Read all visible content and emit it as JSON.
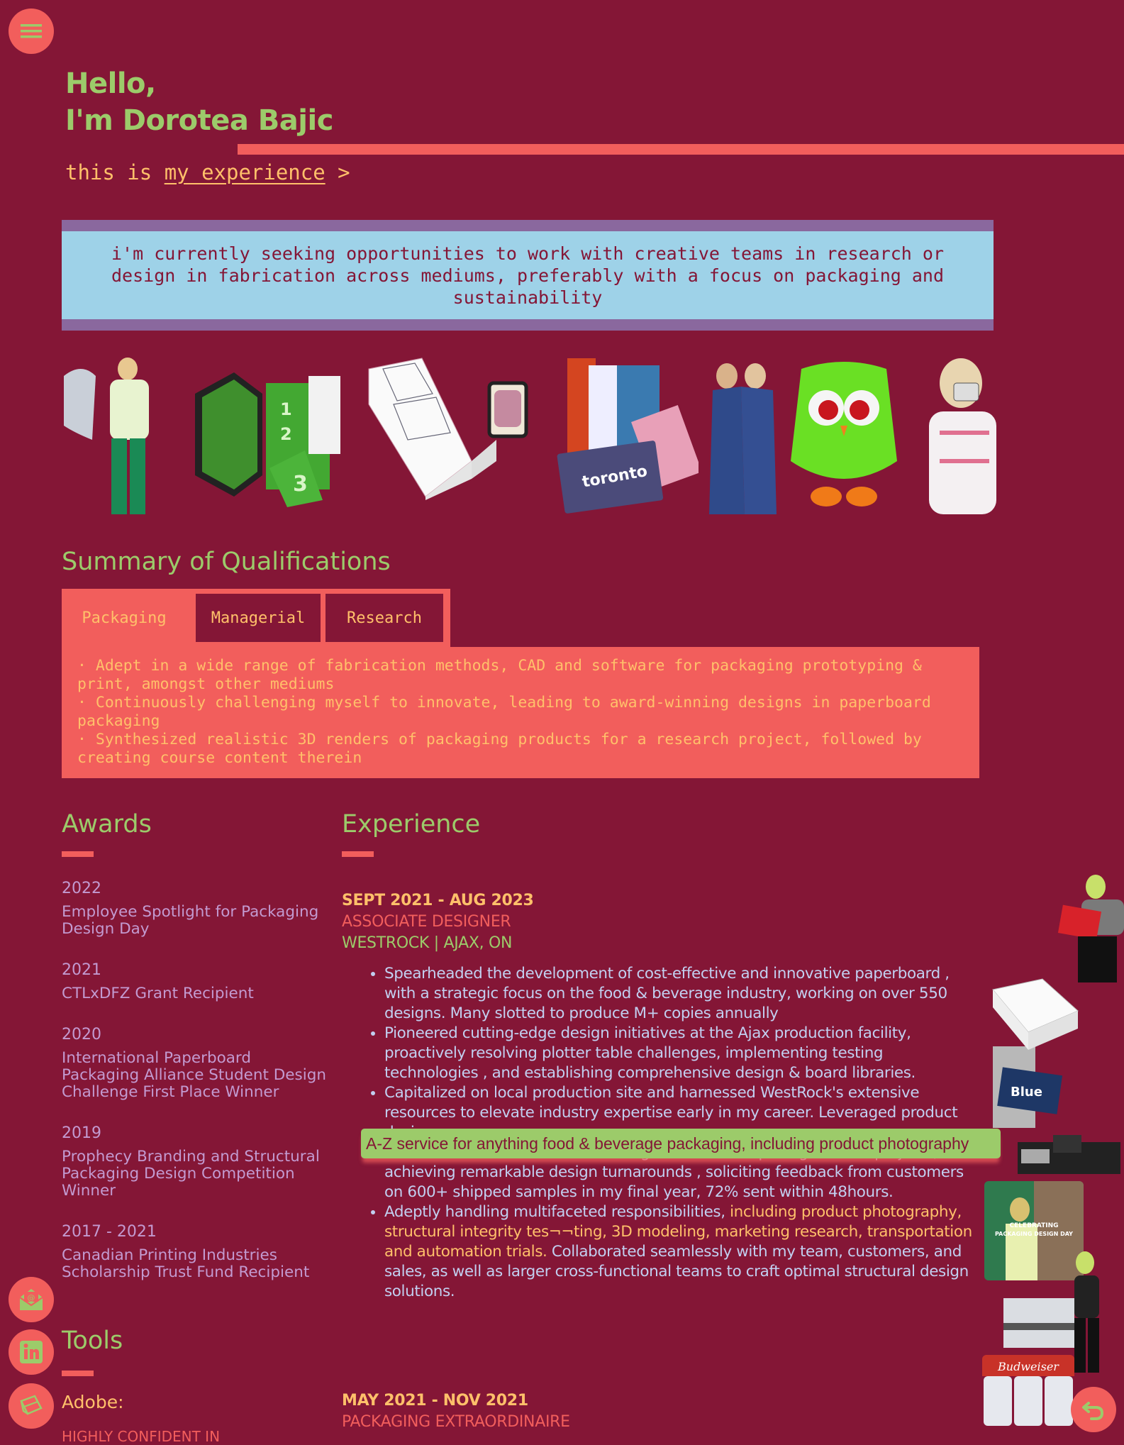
{
  "nav": {
    "menu_icon": "hamburger-menu-icon",
    "email_icon": "envelope-at-icon",
    "linkedin_icon": "linkedin-icon",
    "portfolio_icon": "box-icon",
    "back_icon": "undo-arrow-icon"
  },
  "hero": {
    "greeting": "Hello,",
    "name_line": "I'm Dorotea Bajic",
    "sub_prefix": "this is ",
    "sub_link": "my experience",
    "sub_suffix": " >"
  },
  "seeking": {
    "text": "i'm currently seeking opportunities to work with creative teams in research or design in fabrication across mediums, preferably with a focus on packaging and sustainability"
  },
  "gallery": {
    "images": [
      "person holding paperboard sheets",
      "green hexagonal numbered packaging",
      "white folding carton box dieline",
      "retro tv mini display box",
      "printed graphic cards toronto rewind",
      "two graduates in gowns",
      "green owl figurine",
      "child with camera"
    ]
  },
  "qualifications": {
    "heading": "Summary of Qualifications",
    "tabs": [
      {
        "label": "Packaging",
        "active": true
      },
      {
        "label": "Managerial",
        "active": false
      },
      {
        "label": "Research",
        "active": false
      }
    ],
    "items": [
      "· Adept in a wide range of fabrication methods, CAD and software for packaging prototyping & print, amongst other mediums",
      "· Continuously challenging myself to innovate, leading to award-winning designs in paperboard packaging",
      "· Synthesized realistic 3D renders of packaging products for a research project, followed by creating course content therein"
    ]
  },
  "awards": {
    "heading": "Awards",
    "items": [
      {
        "year": "2022",
        "name": "Employee Spotlight for Packaging Design Day"
      },
      {
        "year": "2021",
        "name": "CTLxDFZ Grant Recipient"
      },
      {
        "year": "2020",
        "name": "International Paperboard Packaging Alliance Student Design Challenge First Place Winner"
      },
      {
        "year": "2019",
        "name": "Prophecy Branding and Structural Packaging Design Competition Winner"
      },
      {
        "year": "2017 - 2021",
        "name": "Canadian Printing Industries Scholarship Trust Fund Recipient"
      }
    ]
  },
  "tools": {
    "heading": "Tools",
    "subheading": "Adobe:",
    "note": "HIGHLY CONFIDENT IN"
  },
  "experience": {
    "heading": "Experience",
    "jobs": [
      {
        "date": "SEPT 2021 - AUG 2023",
        "title": "ASSOCIATE DESIGNER",
        "place": "WESTROCK | AJAX, ON",
        "bullets": [
          "Spearheaded the development of cost-effective and innovative paperboard , with a strategic focus on the food & beverage industry, working on over 550 designs. Many slotted to produce M+ copies annually",
          "Pioneered cutting-edge design initiatives at the Ajax production facility, proactively resolving plotter table challenges, implementing testing technologies , and establishing comprehensive design & board libraries.",
          "Capitalized on local production site and harnessed WestRock's extensive resources to elevate industry expertise early in my career. Leveraged",
          "Orchestrated the concurrent management of multiple high-stakes projects, achieving remarkable design turnarounds , soliciting feedback from customers on 600+ shipped samples in my final year, 72% sent within 48hours."
        ],
        "bullet3_hidden_line": "product design.",
        "bullet5_start": "Adeptly handling multifaceted responsibilities, ",
        "bullet5_highlight": "including product photography, structural integrity tes¬¬ting, 3D modeling, marketing research, transportation and automation trials.",
        "bullet5_end": " Collaborated seamlessly with my team, customers, and sales, as well as larger cross-functional teams to craft optimal structural design solutions."
      },
      {
        "date": "MAY 2021 - NOV 2021",
        "title": "PACKAGING EXTRAORDINAIRE"
      }
    ],
    "tooltip": "A-Z service for anything food & beverage packaging, including product photography"
  },
  "colors": {
    "background": "#841636",
    "accent": "#f25e5c",
    "green": "#9ccb6a",
    "yellow": "#ffc06a",
    "lavender": "#c39ad0",
    "light_blue": "#9ed2e8",
    "purple": "#8a689e"
  }
}
